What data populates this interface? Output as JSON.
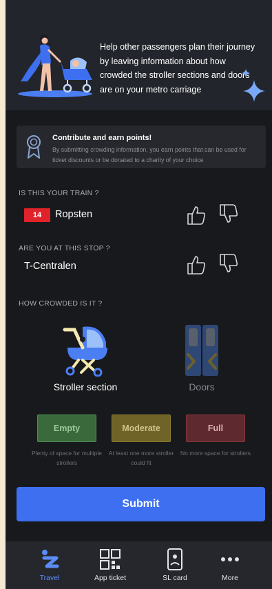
{
  "hero": {
    "text": "Help other passengers plan their journey by leaving information about how crowded the stroller sections and doors are on your metro carriage"
  },
  "info": {
    "title": "Contribute and earn points!",
    "body": "By submitting crowding information, you earn points that can be used for ticket discounts or be donated to a charity of your choice"
  },
  "train_question": {
    "label": "IS THIS YOUR TRAIN ?",
    "line_number": "14",
    "line_color": "#e0232a",
    "destination": "Ropsten"
  },
  "stop_question": {
    "label": "ARE YOU AT THIS STOP ?",
    "stop_name": "T-Centralen"
  },
  "crowd_question": {
    "label": "HOW CROWDED IS IT ?",
    "section_types": [
      {
        "label": "Stroller section",
        "icon": "stroller-icon",
        "selected": true
      },
      {
        "label": "Doors",
        "icon": "doors-icon",
        "selected": false
      }
    ],
    "levels": [
      {
        "label": "Empty",
        "description": "Plenty of space for multiple strollers",
        "color": "#3f7f43"
      },
      {
        "label": "Moderate",
        "description": "At least one more stroller could fit",
        "color": "#8a7a2e"
      },
      {
        "label": "Full",
        "description": "No more space for strollers",
        "color": "#7e2e34"
      }
    ]
  },
  "submit_label": "Submit",
  "tabs": [
    {
      "label": "Travel",
      "icon": "travel-icon",
      "active": true
    },
    {
      "label": "App ticket",
      "icon": "qr-code-icon",
      "active": false
    },
    {
      "label": "SL card",
      "icon": "sl-card-icon",
      "active": false
    },
    {
      "label": "More",
      "icon": "more-dots-icon",
      "active": false
    }
  ],
  "colors": {
    "accent": "#3d6ff0",
    "background": "#18191c",
    "active_tab": "#5b8cf7"
  }
}
